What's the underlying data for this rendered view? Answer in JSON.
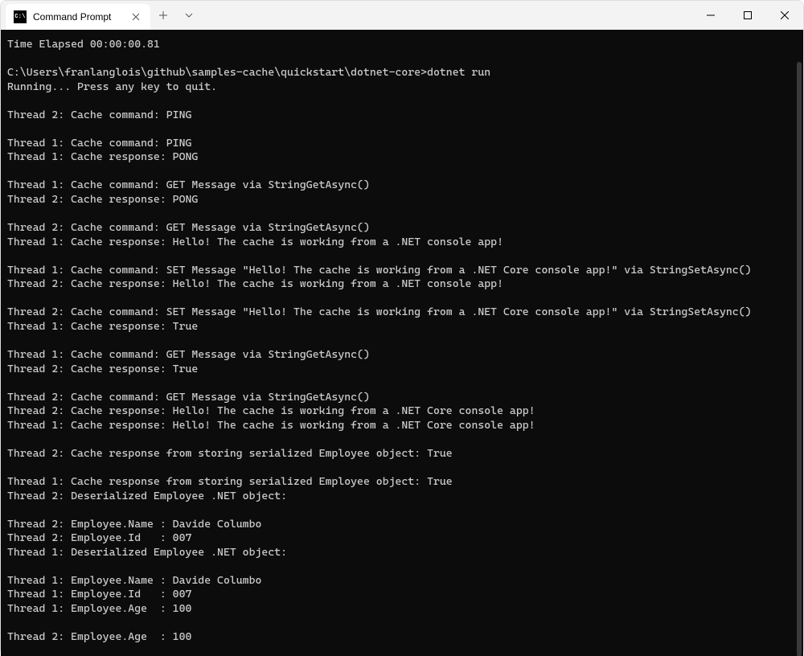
{
  "window": {
    "tab_title": "Command Prompt",
    "tab_icon_text": "C:\\"
  },
  "terminal": {
    "lines": [
      "Time Elapsed 00:00:00.81",
      "",
      "C:\\Users\\franlanglois\\github\\samples-cache\\quickstart\\dotnet-core>dotnet run",
      "Running... Press any key to quit.",
      "",
      "Thread 2: Cache command: PING",
      "",
      "Thread 1: Cache command: PING",
      "Thread 1: Cache response: PONG",
      "",
      "Thread 1: Cache command: GET Message via StringGetAsync()",
      "Thread 2: Cache response: PONG",
      "",
      "Thread 2: Cache command: GET Message via StringGetAsync()",
      "Thread 1: Cache response: Hello! The cache is working from a .NET console app!",
      "",
      "Thread 1: Cache command: SET Message \"Hello! The cache is working from a .NET Core console app!\" via StringSetAsync()",
      "Thread 2: Cache response: Hello! The cache is working from a .NET console app!",
      "",
      "Thread 2: Cache command: SET Message \"Hello! The cache is working from a .NET Core console app!\" via StringSetAsync()",
      "Thread 1: Cache response: True",
      "",
      "Thread 1: Cache command: GET Message via StringGetAsync()",
      "Thread 2: Cache response: True",
      "",
      "Thread 2: Cache command: GET Message via StringGetAsync()",
      "Thread 2: Cache response: Hello! The cache is working from a .NET Core console app!",
      "Thread 1: Cache response: Hello! The cache is working from a .NET Core console app!",
      "",
      "Thread 2: Cache response from storing serialized Employee object: True",
      "",
      "Thread 1: Cache response from storing serialized Employee object: True",
      "Thread 2: Deserialized Employee .NET object:",
      "",
      "Thread 2: Employee.Name : Davide Columbo",
      "Thread 2: Employee.Id   : 007",
      "Thread 1: Deserialized Employee .NET object:",
      "",
      "Thread 1: Employee.Name : Davide Columbo",
      "Thread 1: Employee.Id   : 007",
      "Thread 1: Employee.Age  : 100",
      "",
      "Thread 2: Employee.Age  : 100"
    ]
  }
}
